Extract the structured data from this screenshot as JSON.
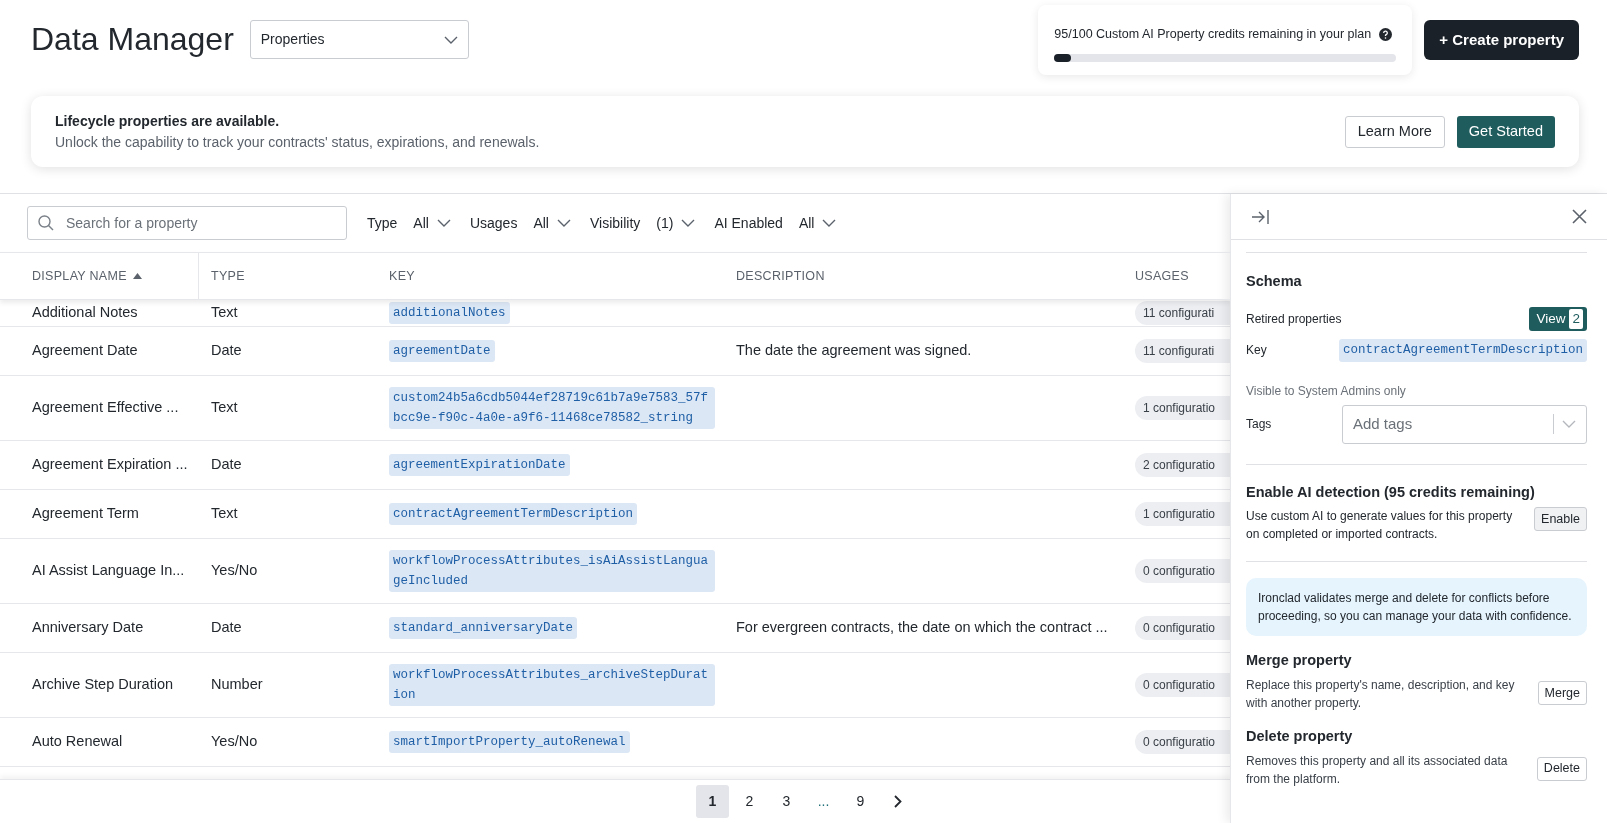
{
  "header": {
    "title": "Data Manager",
    "view_select": {
      "value": "Properties"
    }
  },
  "credits": {
    "text": "95/100 Custom AI Property credits remaining in your plan",
    "level": 0.05
  },
  "create_button": {
    "label": "+ Create property"
  },
  "banner": {
    "title": "Lifecycle properties are available.",
    "text": "Unlock the capability to track your contracts' status, expirations, and renewals.",
    "buttons": [
      {
        "label": "Learn More",
        "kind": "outline"
      },
      {
        "label": "Get Started",
        "kind": "primary"
      }
    ]
  },
  "filters": {
    "search": {
      "placeholder": "Search for a property"
    },
    "items": [
      {
        "label": "Type",
        "value": "All"
      },
      {
        "label": "Usages",
        "value": "All"
      },
      {
        "label": "Visibility",
        "value": "(1)"
      },
      {
        "label": "AI Enabled",
        "value": "All"
      }
    ]
  },
  "table": {
    "columns": [
      {
        "label": "DISPLAY NAME",
        "sorted": true
      },
      {
        "label": "TYPE",
        "sorted": false
      },
      {
        "label": "KEY",
        "sorted": false
      },
      {
        "label": "DESCRIPTION",
        "sorted": false
      },
      {
        "label": "USAGES",
        "sorted": false
      }
    ],
    "rows": [
      {
        "display_name": "Additional Notes",
        "type": "Text",
        "key": "additionalNotes",
        "description": "",
        "usages": "11 configurati"
      },
      {
        "display_name": "Agreement Date",
        "type": "Date",
        "key": "agreementDate",
        "description": "The date the agreement was signed.",
        "usages": "11 configurati"
      },
      {
        "display_name": "Agreement Effective ...",
        "type": "Text",
        "key": "custom24b5a6cdb5044ef28719c61b7a9e7583_57fbcc9e-f90c-4a0e-a9f6-11468ce78582_string",
        "description": "",
        "usages": "1 configuratio"
      },
      {
        "display_name": "Agreement Expiration ...",
        "type": "Date",
        "key": "agreementExpirationDate",
        "description": "",
        "usages": "2 configuratio"
      },
      {
        "display_name": "Agreement Term",
        "type": "Text",
        "key": "contractAgreementTermDescription",
        "description": "",
        "usages": "1 configuratio"
      },
      {
        "display_name": "AI Assist Language In...",
        "type": "Yes/No",
        "key": "workflowProcessAttributes_isAiAssistLanguageIncluded",
        "description": "",
        "usages": "0 configuratio"
      },
      {
        "display_name": "Anniversary Date",
        "type": "Date",
        "key": "standard_anniversaryDate",
        "description": "For evergreen contracts, the date on which the contract ...",
        "usages": "0 configuratio"
      },
      {
        "display_name": "Archive Step Duration",
        "type": "Number",
        "key": "workflowProcessAttributes_archiveStepDuration",
        "description": "",
        "usages": "0 configuratio"
      },
      {
        "display_name": "Auto Renewal",
        "type": "Yes/No",
        "key": "smartImportProperty_autoRenewal",
        "description": "",
        "usages": "0 configuratio"
      }
    ]
  },
  "pagination": {
    "pages": [
      {
        "label": "1",
        "selected": true
      },
      {
        "label": "2",
        "selected": false
      },
      {
        "label": "3",
        "selected": false
      },
      {
        "label": "...",
        "selected": false
      },
      {
        "label": "9",
        "selected": false
      }
    ]
  },
  "panel": {
    "schema": {
      "title": "Schema",
      "retired_label": "Retired properties",
      "view_button": {
        "label": "View",
        "count": "2"
      },
      "key_label": "Key",
      "key_value": "contractAgreementTermDescription",
      "visibility_note": "Visible to System Admins only",
      "tags_label": "Tags",
      "tags_placeholder": "Add tags"
    },
    "sections": [
      {
        "kind": "action",
        "title": "Enable AI detection (95 credits remaining)",
        "text": "Use custom AI to generate values for this property on completed or imported contracts.",
        "button": "Enable"
      },
      {
        "kind": "info",
        "text": "Ironclad validates merge and delete for conflicts before proceeding, so you can manage your data with confidence."
      },
      {
        "kind": "action",
        "title": "Merge property",
        "text": "Replace this property's name, description, and key with another property.",
        "button": "Merge"
      },
      {
        "kind": "action",
        "title": "Delete property",
        "text": "Removes this property and all its associated data from the platform.",
        "button": "Delete"
      }
    ]
  }
}
